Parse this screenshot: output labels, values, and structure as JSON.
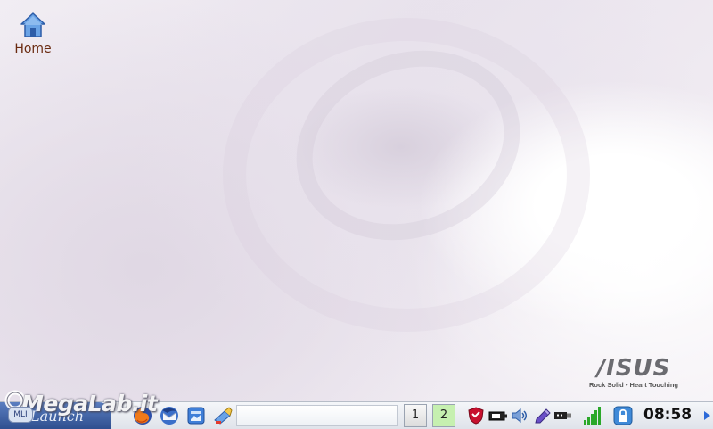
{
  "desktop": {
    "icons": [
      {
        "label": "Home",
        "icon": "home-icon"
      }
    ]
  },
  "branding": {
    "wordmark": "/ISUS",
    "tagline": "Rock Solid • Heart Touching"
  },
  "watermark": {
    "text": "MegaLab.it",
    "badge": "MLI"
  },
  "taskbar": {
    "start_label": "Launch",
    "quick_launch": [
      {
        "name": "firefox-icon"
      },
      {
        "name": "thunderbird-icon"
      },
      {
        "name": "file-manager-icon"
      },
      {
        "name": "paint-icon"
      }
    ],
    "desktops": [
      "1",
      "2"
    ],
    "active_desktop": "2",
    "tray": [
      {
        "name": "shield-icon"
      },
      {
        "name": "battery-icon"
      },
      {
        "name": "volume-icon"
      },
      {
        "name": "pen-icon"
      },
      {
        "name": "usb-icon"
      },
      {
        "name": "wifi-signal-icon"
      },
      {
        "name": "lock-icon"
      }
    ],
    "clock": "08:58"
  },
  "colors": {
    "start_gradient_top": "#5a7ec0",
    "active_desktop_bg": "#c6f0b0",
    "home_label": "#6a2a10"
  }
}
